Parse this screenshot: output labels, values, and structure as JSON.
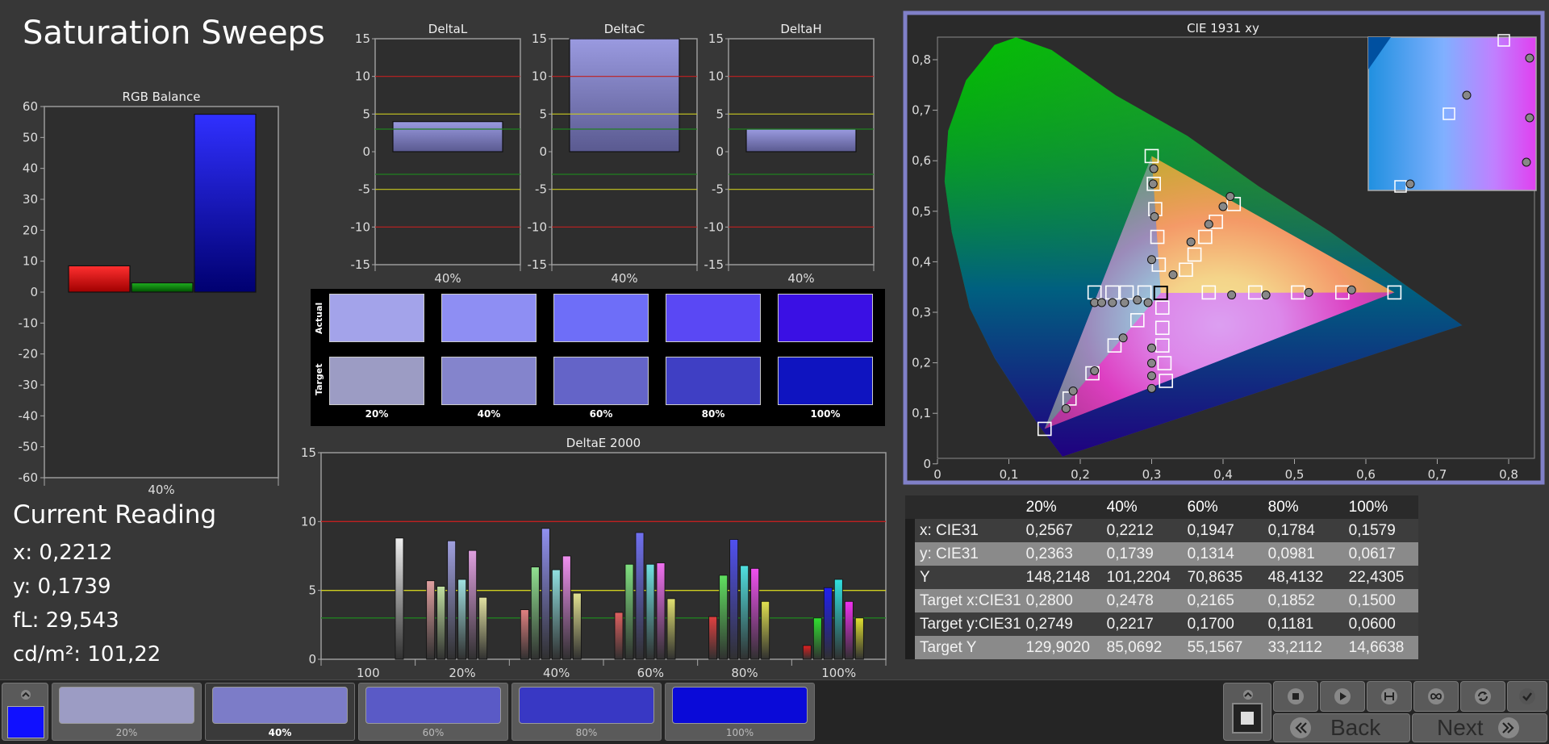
{
  "page_title": "Saturation Sweeps",
  "rgb_balance": {
    "title": "RGB Balance",
    "y_ticks": [
      "60",
      "50",
      "40",
      "30",
      "20",
      "10",
      "0",
      "-10",
      "-20",
      "-30",
      "-40",
      "-50",
      "-60"
    ],
    "x_label": "40%",
    "colors": {
      "red": "#ff0000",
      "green": "#00a000",
      "blue": "#2020ff"
    }
  },
  "delta_charts": [
    {
      "title": "DeltaL",
      "x_label": "40%"
    },
    {
      "title": "DeltaC",
      "x_label": "40%"
    },
    {
      "title": "DeltaH",
      "x_label": "40%"
    }
  ],
  "delta_y_ticks": [
    "15",
    "10",
    "5",
    "0",
    "-5",
    "-10",
    "-15"
  ],
  "swatches": {
    "row_labels": [
      "Actual",
      "Target"
    ],
    "columns": [
      "20%",
      "40%",
      "60%",
      "80%",
      "100%"
    ],
    "actual_colors": [
      "#a3a3ea",
      "#8e8ef3",
      "#6e6ef8",
      "#5a48f4",
      "#3a10e4"
    ],
    "target_colors": [
      "#9c9cc4",
      "#8484cc",
      "#6464c8",
      "#3f3fc4",
      "#0f14c0"
    ]
  },
  "delta_e": {
    "title": "DeltaE 2000",
    "y_ticks": [
      "15",
      "10",
      "5",
      "0"
    ],
    "x_labels": [
      "100",
      "20%",
      "40%",
      "60%",
      "80%",
      "100%"
    ]
  },
  "cie": {
    "title": "CIE 1931 xy",
    "x_ticks": [
      "0",
      "0,1",
      "0,2",
      "0,3",
      "0,4",
      "0,5",
      "0,6",
      "0,7",
      "0,8"
    ],
    "y_ticks": [
      "0,8",
      "0,7",
      "0,6",
      "0,5",
      "0,4",
      "0,3",
      "0,2",
      "0,1",
      "0"
    ],
    "border_color": "#8080c8"
  },
  "current_reading": {
    "title": "Current Reading",
    "x": "x: 0,2212",
    "y": "y: 0,1739",
    "fl": "fL: 29,543",
    "cdm2": "cd/m²: 101,22"
  },
  "table": {
    "headers": [
      "",
      "20%",
      "40%",
      "60%",
      "80%",
      "100%"
    ],
    "rows": [
      [
        "x: CIE31",
        "0,2567",
        "0,2212",
        "0,1947",
        "0,1784",
        "0,1579"
      ],
      [
        "y: CIE31",
        "0,2363",
        "0,1739",
        "0,1314",
        "0,0981",
        "0,0617"
      ],
      [
        "Y",
        "148,2148",
        "101,2204",
        "70,8635",
        "48,4132",
        "22,4305"
      ],
      [
        "Target x:CIE31",
        "0,2800",
        "0,2478",
        "0,2165",
        "0,1852",
        "0,1500"
      ],
      [
        "Target y:CIE31",
        "0,2749",
        "0,2217",
        "0,1700",
        "0,1181",
        "0,0600"
      ],
      [
        "Target Y",
        "129,9020",
        "85,0692",
        "55,1567",
        "33,2112",
        "14,6638"
      ]
    ]
  },
  "bottom_nav": {
    "current_color": "#1010ff",
    "tabs": [
      {
        "label": "20%",
        "color": "#9c9cc4"
      },
      {
        "label": "40%",
        "color": "#7c7cc8"
      },
      {
        "label": "60%",
        "color": "#5a5ac6"
      },
      {
        "label": "80%",
        "color": "#3838c4"
      },
      {
        "label": "100%",
        "color": "#0a0ad8"
      }
    ],
    "back_label": "Back",
    "next_label": "Next"
  }
}
